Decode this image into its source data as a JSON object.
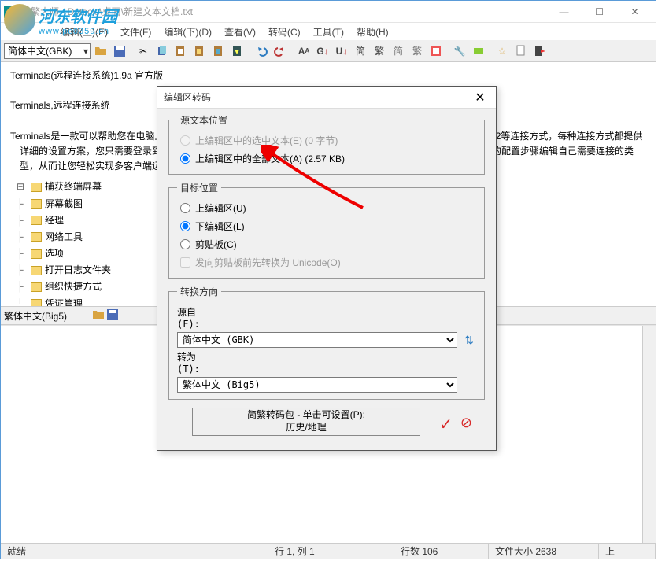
{
  "window": {
    "title": "简繁大师 - D:\\tools\\桌面\\新建文本文档.txt",
    "controls": {
      "min": "—",
      "max": "☐",
      "close": "✕"
    }
  },
  "watermark": {
    "brand": "河东软件园",
    "url": "www.pc0359.cn"
  },
  "menu": {
    "items": [
      "编辑(上)(E)",
      "文件(F)",
      "编辑(下)(D)",
      "查看(V)",
      "转码(C)",
      "工具(T)",
      "帮助(H)"
    ]
  },
  "toolbar_top": {
    "encoding": "简体中文(GBK)"
  },
  "content": {
    "line1": "Terminals(远程连接系统)1.9a 官方版",
    "line2": "Terminals,远程连接系统",
    "line3": "Terminals是一款可以帮助您在电脑上加载远程信息的工具，支持 RDP、VNC、VMRC、SSH2、Telne、SSH1、SSH2等连接方式，每种连接方式都提供详细的设置方案，您只需要登录到前端的加载界面就可以立即开始配置连接，当您启动软件的时候就可以根据软件的配置步骤编辑自己需要连接的类型，从而让您轻松实现多客户端远程加载数据的功能，需要的朋友赶快下载本软件！"
  },
  "tree": {
    "items": [
      "捕获终端屏幕",
      "屏幕截图",
      "经理",
      "网络工具",
      "选项",
      "打开日志文件夹",
      "组织快捷方式",
      "凭证管理"
    ]
  },
  "toolbar_lower": {
    "encoding": "繁体中文(Big5)"
  },
  "dialog": {
    "title": "编辑区转码",
    "source": {
      "legend": "源文本位置",
      "opt_selected": "上编辑区中的选中文本(E) (0 字节)",
      "opt_all": "上编辑区中的全部文本(A) (2.57 KB)"
    },
    "target": {
      "legend": "目标位置",
      "opt_upper": "上编辑区(U)",
      "opt_lower": "下编辑区(L)",
      "opt_clip": "剪贴板(C)",
      "chk_unicode": "发向剪贴板前先转换为 Unicode(O)"
    },
    "direction": {
      "legend": "转换方向",
      "from_label": "源自(F):",
      "from_value": "简体中文 (GBK)",
      "to_label": "转为(T):",
      "to_value": "繁体中文 (Big5)"
    },
    "convert_btn_l1": "简繁转码包 - 单击可设置(P):",
    "convert_btn_l2": "历史/地理"
  },
  "status": {
    "ready": "就绪",
    "pos": "行 1, 列 1",
    "lines": "行数 106",
    "size": "文件大小 2638",
    "tail": "上"
  }
}
